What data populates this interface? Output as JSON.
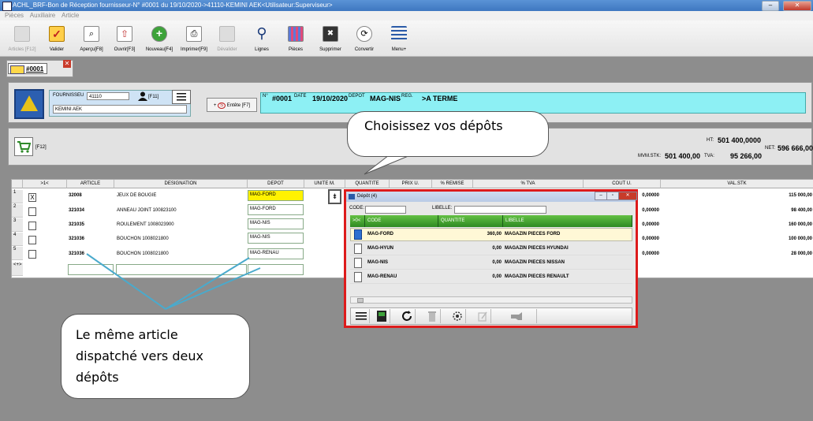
{
  "window": {
    "title": "ACHL_BRF-Bon de Réception fournisseur-N° #0001 du 19/10/2020->41110-KEMINI AEK<Utilisateur:Superviseur>",
    "min": "–",
    "max": "▫",
    "close": "✕"
  },
  "menu": [
    "Pièces",
    "Auxiliaire",
    "Article"
  ],
  "toolbar": [
    {
      "label": "Articles [F12]",
      "icon": "articles-icon",
      "disabled": true
    },
    {
      "label": "Valider",
      "icon": "check-icon",
      "disabled": false
    },
    {
      "label": "Aperçu[F8]",
      "icon": "preview-icon",
      "disabled": false
    },
    {
      "label": "Ouvrir[F3]",
      "icon": "open-icon",
      "disabled": false
    },
    {
      "label": "Nouveau[F4]",
      "icon": "new-icon",
      "disabled": false
    },
    {
      "label": "Imprimer[F9]",
      "icon": "print-icon",
      "disabled": false
    },
    {
      "label": "Dévalider",
      "icon": "unvalidate-icon",
      "disabled": true
    },
    {
      "label": "Lignes",
      "icon": "search-icon",
      "disabled": false
    },
    {
      "label": "Pièces",
      "icon": "pieces-icon",
      "disabled": false
    },
    {
      "label": "Supprimer",
      "icon": "delete-icon",
      "disabled": false
    },
    {
      "label": "Convertir",
      "icon": "convert-icon",
      "disabled": false
    },
    {
      "label": "Menu+",
      "icon": "menu-icon",
      "disabled": false
    }
  ],
  "tab": {
    "label": "#0001",
    "close": "✕"
  },
  "supplier": {
    "label": "FOURNISSEU",
    "code": "41110",
    "name": "KEMINI AEK",
    "f11": "[F11]"
  },
  "entete": {
    "label": "Entête [F7]",
    "s": "S",
    "plus": "+"
  },
  "info": {
    "n_label": "N°",
    "number": "#0001",
    "date_label": "DATE",
    "date": "19/10/2020",
    "depot_label": "DEPOT",
    "depot": "MAG-NIS",
    "reg_label": "REG.",
    "reg": ">A TERME"
  },
  "f12": "[F12]",
  "totals": {
    "ht_label": "HT:",
    "ht": "501 400,0000",
    "mvm_label": "MVM.STK:",
    "mvm": "501 400,00",
    "tva_label": "TVA:",
    "tva": "95 266,00",
    "net_label": "NET:",
    "net": "596 666,00"
  },
  "grid": {
    "headers": [
      ">1<",
      "ARTICLE",
      "DESIGNATION",
      "DEPOT",
      "UNITE M.",
      "QUANTITE",
      "PRIX U.",
      "% REMISE",
      "% TVA",
      "COUT U.",
      "VAL.STK"
    ],
    "rows": [
      {
        "n": "1",
        "check": "X",
        "article": "32008",
        "designation": "JEUX DE BOUGIE",
        "depot": "MAG-FORD",
        "cout": "0,00000",
        "val": "115 000,00"
      },
      {
        "n": "2",
        "check": "",
        "article": "321034",
        "designation": "ANNEAU JOINT 100823100",
        "depot": "MAG-FORD",
        "cout": "0,00000",
        "val": "98 400,00"
      },
      {
        "n": "3",
        "check": "",
        "article": "321035",
        "designation": "ROULEMENT 1008023900",
        "depot": "MAG-NIS",
        "cout": "0,00000",
        "val": "160 000,00"
      },
      {
        "n": "4",
        "check": "",
        "article": "321036",
        "designation": "BOUCHON 1008021800",
        "depot": "MAG-NIS",
        "cout": "0,00000",
        "val": "100 000,00"
      },
      {
        "n": "5",
        "check": "",
        "article": "321036",
        "designation": "BOUCHON 1008021800",
        "depot": "MAG-RENAU",
        "cout": "0,00000",
        "val": "28 000,00"
      }
    ],
    "new_row": "<+>"
  },
  "depot_button": "⇟",
  "popup": {
    "title": "Dépôt (4)",
    "code_label": "CODE:",
    "libelle_label": "LIBELLE:",
    "headers": [
      ">0<",
      "CODE",
      "QUANTITE",
      "LIBELLE"
    ],
    "rows": [
      {
        "code": "MAG-FORD",
        "qty": "360,00",
        "lib": "MAGAZIN PIECES FORD",
        "checked": true
      },
      {
        "code": "MAG-HYUN",
        "qty": "0,00",
        "lib": "MAGAZIN PIECES HYUNDAI",
        "checked": false
      },
      {
        "code": "MAG-NIS",
        "qty": "0,00",
        "lib": "MAGAZIN PIECES NISSAN",
        "checked": false
      },
      {
        "code": "MAG-RENAU",
        "qty": "0,00",
        "lib": "MAGAZIN PIECES RENAULT",
        "checked": false
      }
    ]
  },
  "callouts": {
    "top": "Choisissez vos dépôts",
    "bottom1": "Le même article",
    "bottom2": "dispatché vers deux",
    "bottom3": "dépôts"
  },
  "colors": {
    "cyan": "#8df0f4",
    "green": "#2e8a23",
    "red": "#dd1b1b",
    "yellow": "#fff200"
  }
}
